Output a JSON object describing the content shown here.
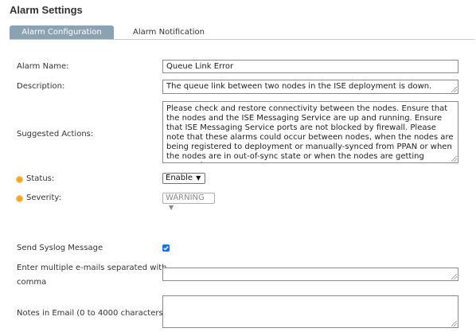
{
  "page": {
    "title": "Alarm Settings"
  },
  "tabs": [
    {
      "label": "Alarm Configuration",
      "active": true
    },
    {
      "label": "Alarm Notification",
      "active": false
    }
  ],
  "form": {
    "alarm_name": {
      "label": "Alarm Name:",
      "value": "Queue Link Error"
    },
    "description": {
      "label": "Description:",
      "value": "The queue link between two nodes in the ISE deployment is down."
    },
    "suggested_actions": {
      "label": "Suggested Actions:",
      "value": "Please check and restore connectivity between the nodes. Ensure that the nodes and the ISE Messaging Service are up and running. Ensure that ISE Messaging Service ports are not blocked by firewall. Please note that these alarms could occur between nodes, when the nodes are being registered to deployment or manually-synced from PPAN or when the nodes are in out-of-sync state or when the nodes are getting restarted."
    },
    "status": {
      "label": "Status:",
      "value": "Enable",
      "required": true
    },
    "severity": {
      "label": "Severity:",
      "value": "WARNING",
      "required": true,
      "disabled": true
    },
    "send_syslog": {
      "label": "Send Syslog Message",
      "checked": true
    },
    "emails": {
      "label_line1": "Enter multiple e-mails separated with",
      "label_line2": "comma",
      "value": ""
    },
    "notes": {
      "label": "Notes in Email (0 to 4000 characters)",
      "value": ""
    }
  },
  "colors": {
    "tab_active": "#8aa2b2",
    "required_dot": "#f5a623",
    "checkbox": "#1a73e8"
  }
}
